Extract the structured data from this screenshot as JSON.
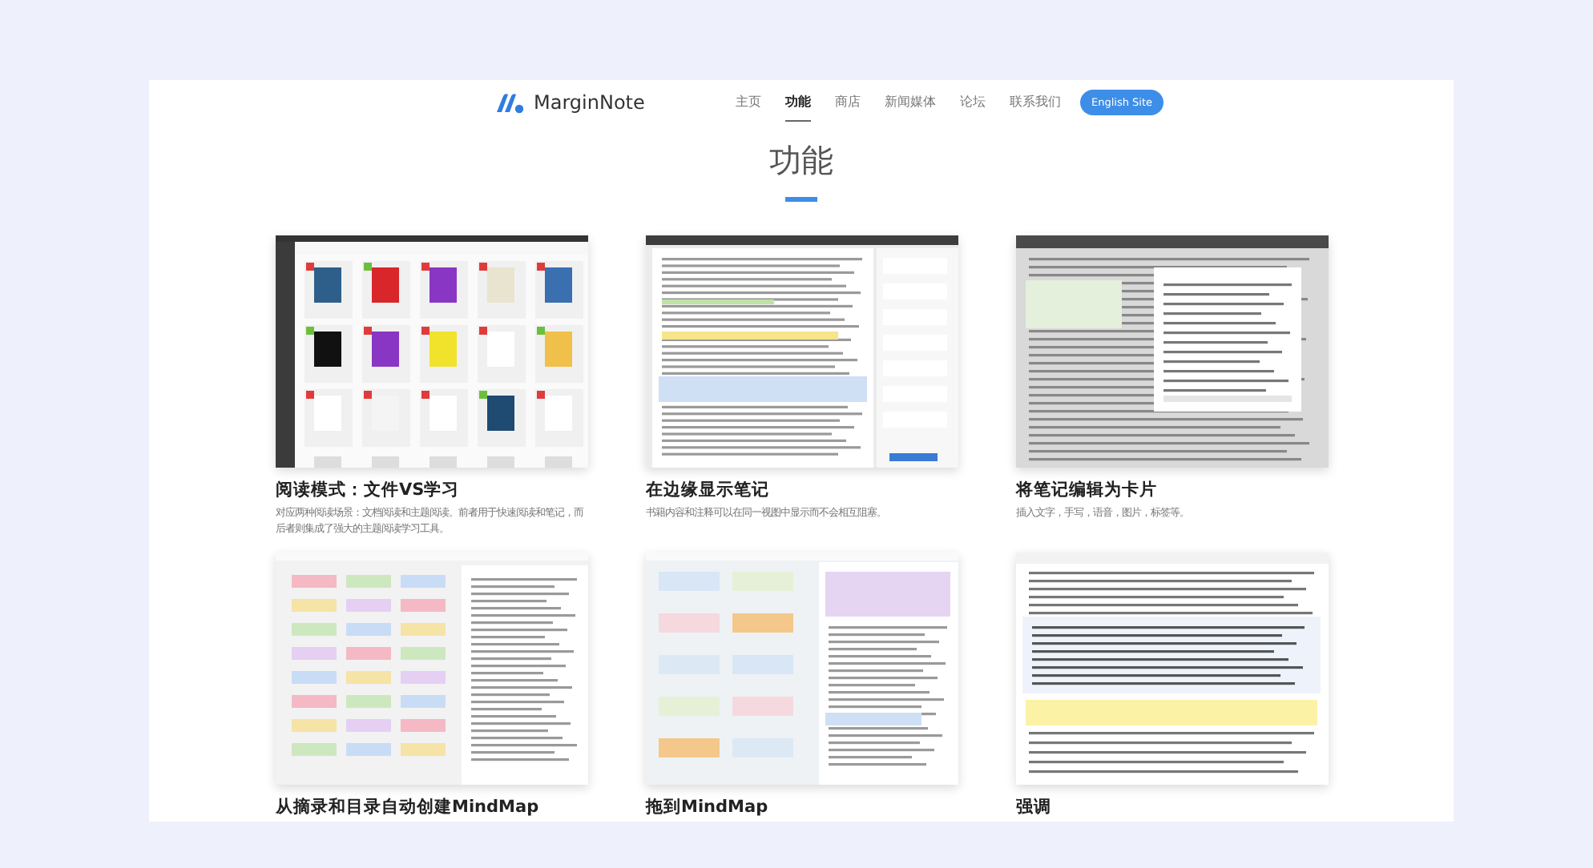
{
  "brand": {
    "name": "MarginNote"
  },
  "nav": [
    {
      "label": "主页",
      "selected": false
    },
    {
      "label": "功能",
      "selected": true
    },
    {
      "label": "商店",
      "selected": false
    },
    {
      "label": "新闻媒体",
      "selected": false
    },
    {
      "label": "论坛",
      "selected": false
    },
    {
      "label": "联系我们",
      "selected": false
    }
  ],
  "language_button": "English Site",
  "heading": "功能",
  "features": [
    {
      "title": "阅读模式：文件VS学习",
      "description": "对应两种阅读场景：文档阅读和主题阅读。前者用于快速阅读和笔记，而后者则集成了强大的主题阅读学习工具。",
      "kind": "library"
    },
    {
      "title": "在边缘显示笔记",
      "description": "书籍内容和注释可以在同一视图中显示而不会相互阻塞。",
      "kind": "reader"
    },
    {
      "title": "将笔记编辑为卡片",
      "description": "插入文字，手写，语音，图片，标签等。",
      "kind": "card"
    },
    {
      "title": "从摘录和目录自动创建MindMap",
      "kind": "outline"
    },
    {
      "title": "拖到MindMap",
      "kind": "mindmap"
    },
    {
      "title": "强调",
      "kind": "emphasis"
    }
  ]
}
